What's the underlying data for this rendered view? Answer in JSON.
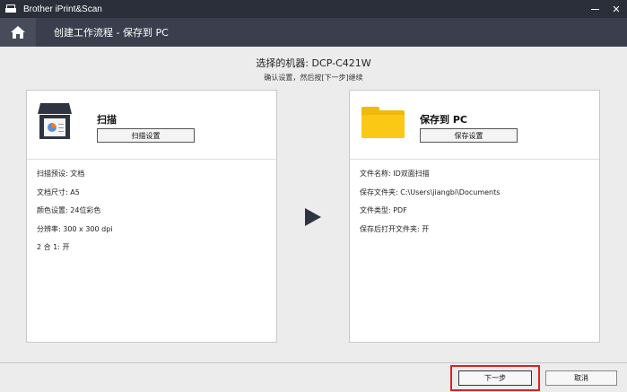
{
  "window": {
    "title": "Brother iPrint&Scan",
    "minimize_icon": "minimize-icon",
    "close_glyph": "✕"
  },
  "header": {
    "home_icon": "home-icon",
    "breadcrumb": "创建工作流程 - 保存到 PC"
  },
  "device": {
    "label": "选择的机器: DCP-C421W",
    "hint": "确认设置，然后按[下一步]继续"
  },
  "scan_card": {
    "icon": "scanner-icon",
    "title": "扫描",
    "button_label": "扫描设置",
    "properties": [
      "扫描预设: 文档",
      "文档尺寸: A5",
      "颜色设置: 24位彩色",
      "分辨率: 300 x 300 dpi",
      "2 合 1: 开"
    ]
  },
  "arrow_icon": "play-arrow-icon",
  "save_card": {
    "icon": "folder-icon",
    "title": "保存到 PC",
    "button_label": "保存设置",
    "properties": [
      "文件名称: ID双面扫描",
      "保存文件夹: C:\\Users\\jiangbi\\Documents",
      "文件类型: PDF",
      "保存后打开文件夹: 开"
    ]
  },
  "footer": {
    "next_label": "下一步",
    "cancel_label": "取消",
    "highlight_color": "#e02020"
  }
}
